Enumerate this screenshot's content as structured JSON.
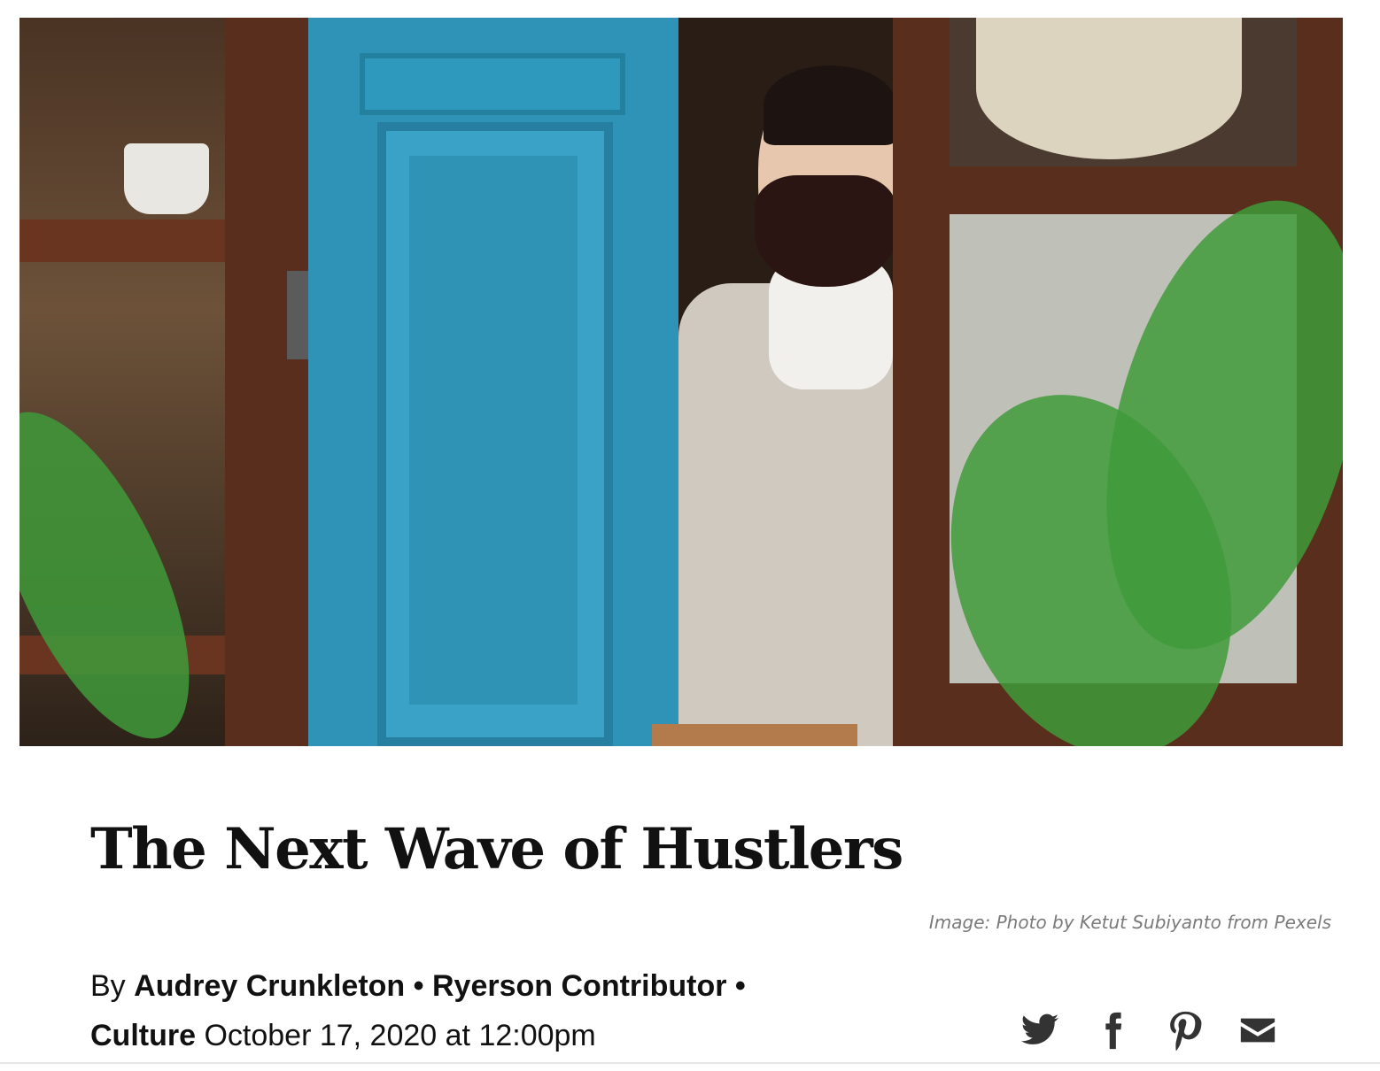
{
  "hero": {
    "image_alt": "Woman in a face mask holding a welcome sign at the door of a shop",
    "caption": "Image: Photo by Ketut Subiyanto from Pexels"
  },
  "article": {
    "title": "The Next Wave of Hustlers",
    "byline_prefix": "By",
    "author": "Audrey Crunkleton",
    "separator": "•",
    "role": "Ryerson Contributor",
    "section": "Culture",
    "date": "October 17, 2020 at 12:00pm"
  },
  "share": {
    "icons": [
      "twitter-icon",
      "facebook-icon",
      "pinterest-icon",
      "email-icon"
    ]
  },
  "colors": {
    "text": "#111111",
    "caption": "#7a7a7a",
    "icon": "#333333",
    "door_blue": "#2e93b7"
  }
}
